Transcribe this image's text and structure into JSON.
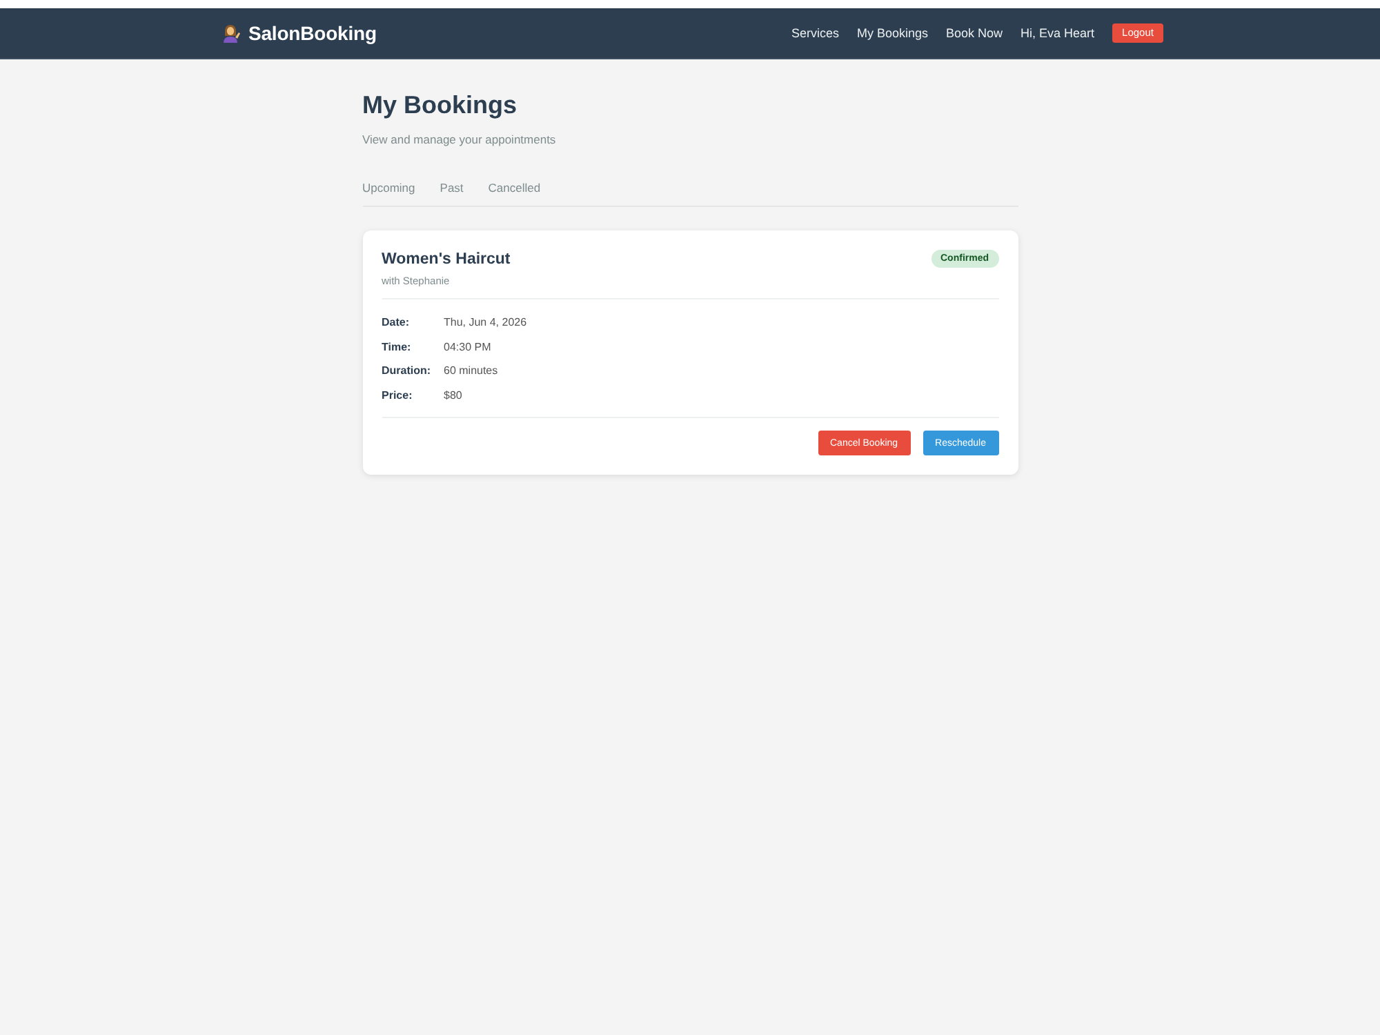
{
  "navbar": {
    "brand": "SalonBooking",
    "links": [
      "Services",
      "My Bookings",
      "Book Now"
    ],
    "greeting": "Hi, Eva Heart",
    "logout": "Logout"
  },
  "page": {
    "title": "My Bookings",
    "subtitle": "View and manage your appointments"
  },
  "tabs": [
    "Upcoming",
    "Past",
    "Cancelled"
  ],
  "bookings": [
    {
      "service": "Women's Haircut",
      "stylist": "with Stephanie",
      "status": {
        "label": "Confirmed",
        "kind": "confirmed"
      },
      "details": [
        {
          "label": "Date:",
          "value": "Thu, Jun 4, 2026"
        },
        {
          "label": "Time:",
          "value": "04:30 PM"
        },
        {
          "label": "Duration:",
          "value": "60 minutes"
        },
        {
          "label": "Price:",
          "value": "$80"
        }
      ],
      "actions": [
        {
          "label": "Cancel Booking",
          "kind": "danger"
        },
        {
          "label": "Reschedule",
          "kind": "primary"
        }
      ]
    }
  ]
}
